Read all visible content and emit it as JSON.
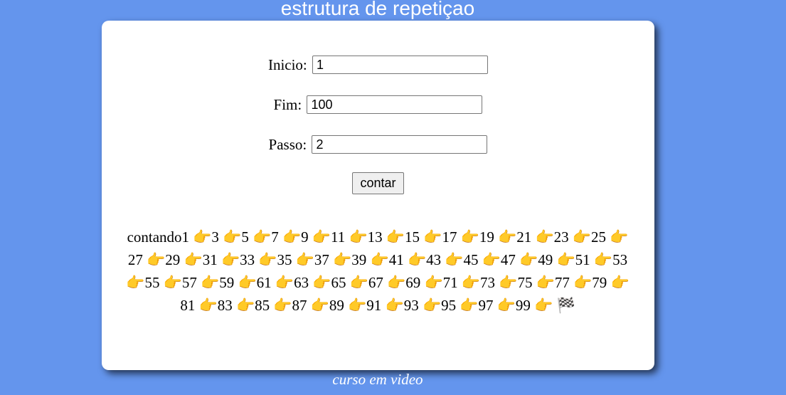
{
  "header": {
    "title": "estrutura de repetiçao"
  },
  "form": {
    "inicio": {
      "label": "Inicio:",
      "value": "1"
    },
    "fim": {
      "label": "Fim:",
      "value": "100"
    },
    "passo": {
      "label": "Passo:",
      "value": "2"
    },
    "button_label": "contar"
  },
  "result": {
    "text": "contando1 👉3 👉5 👉7 👉9 👉11 👉13 👉15 👉17 👉19 👉21 👉23 👉25 👉27 👉29 👉31 👉33 👉35 👉37 👉39 👉41 👉43 👉45 👉47 👉49 👉51 👉53 👉55 👉57 👉59 👉61 👉63 👉65 👉67 👉69 👉71 👉73 👉75 👉77 👉79 👉81 👉83 👉85 👉87 👉89 👉91 👉93 👉95 👉97 👉99 👉 🏁"
  },
  "footer": {
    "text": "curso em video"
  }
}
